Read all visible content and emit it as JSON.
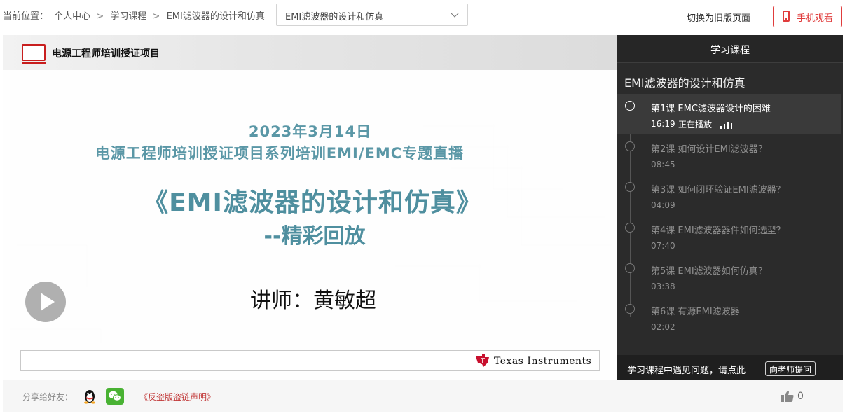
{
  "breadcrumb": {
    "label": "当前位置：",
    "items": [
      "个人中心",
      "学习课程",
      "EMI滤波器的设计和仿真"
    ],
    "separator": ">"
  },
  "course_select": {
    "selected": "EMI滤波器的设计和仿真",
    "icon": "chevron-down-icon"
  },
  "header_actions": {
    "old_version": "切换为旧版页面",
    "mobile": "手机观看",
    "accent": "#e03c3c"
  },
  "player": {
    "brand": "电源工程师培训授证项目",
    "slide": {
      "date": "2023年3月14日",
      "subtitle": "电源工程师培训授证项目系列培训EMI/EMC专题直播",
      "title": "《EMI滤波器的设计和仿真》",
      "replay": "--精彩回放",
      "lecturer": "讲师：黄敏超",
      "title_color": "#4f8f9f"
    },
    "sponsor": "Texas Instruments",
    "play_icon": "play-icon"
  },
  "sidebar": {
    "header": "学习课程",
    "course_title": "EMI滤波器的设计和仿真",
    "lessons": [
      {
        "title": "第1课 EMC滤波器设计的困难",
        "time": "16:19",
        "status": "正在播放"
      },
      {
        "title": "第2课 如何设计EMI滤波器？",
        "time": "08:45"
      },
      {
        "title": "第3课 如何闭环验证EMI滤波器？",
        "time": "04:09"
      },
      {
        "title": "第4课 EMI滤波器器件如何选型？",
        "time": "07:40"
      },
      {
        "title": "第5课 EMI滤波器如何仿真？",
        "time": "03:38"
      },
      {
        "title": "第6课 有源EMI滤波器",
        "time": "02:02"
      }
    ],
    "footer_text": "学习课程中遇见问题，请点此",
    "ask_button": "向老师提问"
  },
  "bottom": {
    "share_label": "分享给好友：",
    "share_icons": [
      "qq-icon",
      "wechat-icon"
    ],
    "piracy_notice": "《反盗版盗链声明》",
    "likes": "0"
  }
}
